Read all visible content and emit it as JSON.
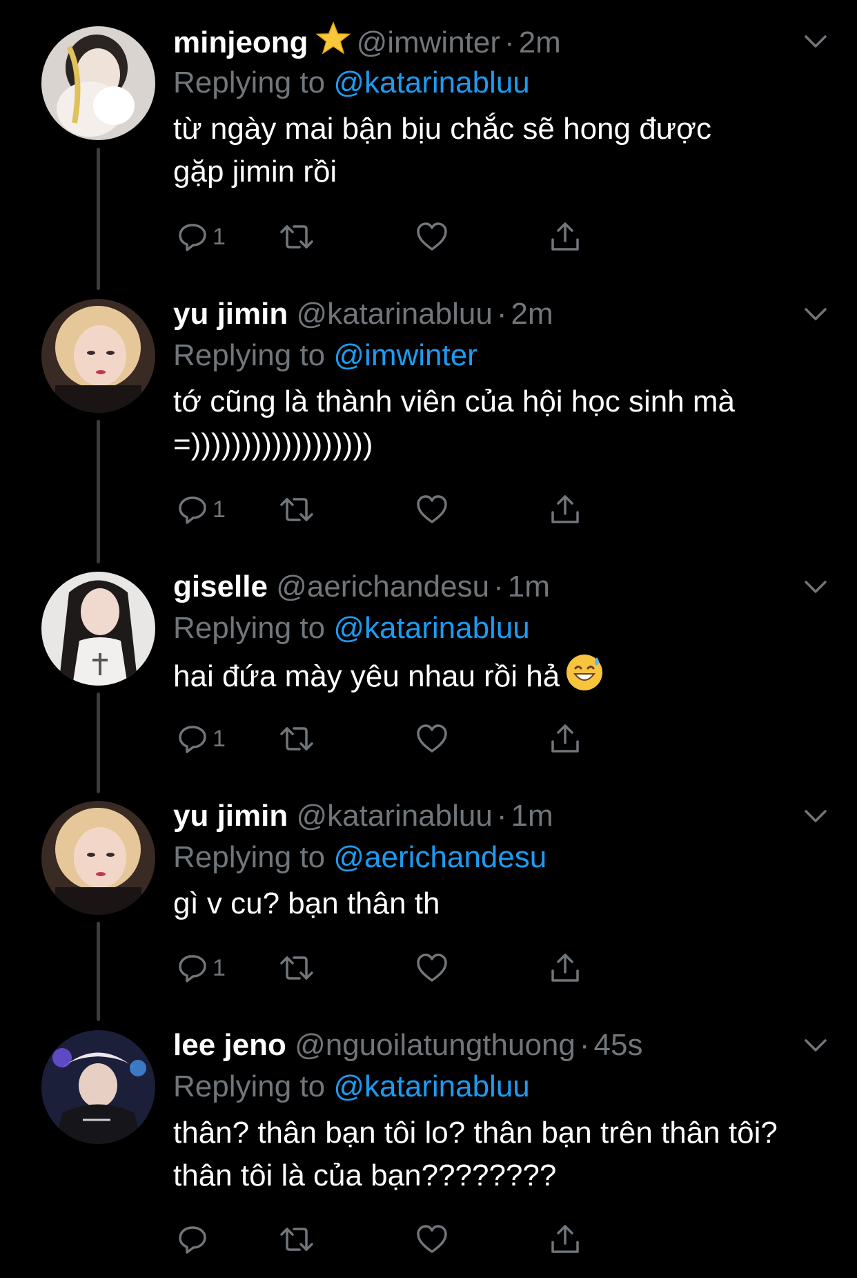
{
  "colors": {
    "background": "#000000",
    "name": "#ffffff",
    "muted": "#71767b",
    "mention": "#1d9bf0",
    "connector": "#3a3d40"
  },
  "tweets": [
    {
      "display_name": "minjeong",
      "badge": "star-emoji",
      "handle": "@imwinter",
      "separator": "·",
      "time": "2m",
      "reply_prefix": "Replying to",
      "reply_to": "@katarinabluu",
      "text": "từ ngày mai bận bịu chắc sẽ hong được gặp jimin rồi",
      "reply_count": "1"
    },
    {
      "display_name": "yu jimin",
      "handle": "@katarinabluu",
      "separator": "·",
      "time": "2m",
      "reply_prefix": "Replying to",
      "reply_to": "@imwinter",
      "text": "tớ cũng là thành viên của hội học sinh mà =))))))))))))))))))",
      "reply_count": "1"
    },
    {
      "display_name": "giselle",
      "handle": "@aerichandesu",
      "separator": "·",
      "time": "1m",
      "reply_prefix": "Replying to",
      "reply_to": "@katarinabluu",
      "text": "hai đứa mày yêu nhau rồi hả",
      "emoji": "grinning-sweat-emoji",
      "reply_count": "1"
    },
    {
      "display_name": "yu jimin",
      "handle": "@katarinabluu",
      "separator": "·",
      "time": "1m",
      "reply_prefix": "Replying to",
      "reply_to": "@aerichandesu",
      "text": "gì v cu? bạn thân th",
      "reply_count": "1"
    },
    {
      "display_name": "lee jeno",
      "handle": "@nguoilatungthuong",
      "separator": "·",
      "time": "45s",
      "reply_prefix": "Replying to",
      "reply_to": "@katarinabluu",
      "text": "thân? thân bạn tôi lo? thân bạn trên thân tôi? thân tôi là của bạn????????",
      "reply_count": ""
    }
  ]
}
